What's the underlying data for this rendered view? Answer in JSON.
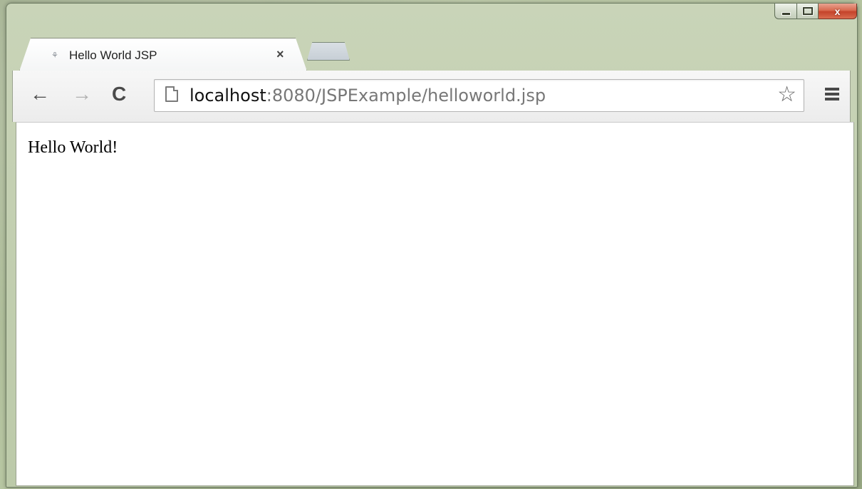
{
  "window": {
    "caption_buttons": {
      "minimize_label": "",
      "maximize_label": "",
      "close_label": "x"
    }
  },
  "tabs": [
    {
      "title": "Hello World JSP",
      "close_label": "×",
      "favicon": "page-icon"
    }
  ],
  "toolbar": {
    "back_label": "←",
    "forward_label": "→",
    "reload_label": "C",
    "address": {
      "host": "localhost",
      "path": ":8080/JSPExample/helloworld.jsp"
    },
    "bookmark_label": "☆",
    "menu_icon": "hamburger-menu-icon"
  },
  "page": {
    "text": "Hello World!"
  },
  "colors": {
    "window_frame": "#bccaa9",
    "close_button": "#c4432a",
    "url_host": "#111111",
    "url_path": "#777777"
  }
}
